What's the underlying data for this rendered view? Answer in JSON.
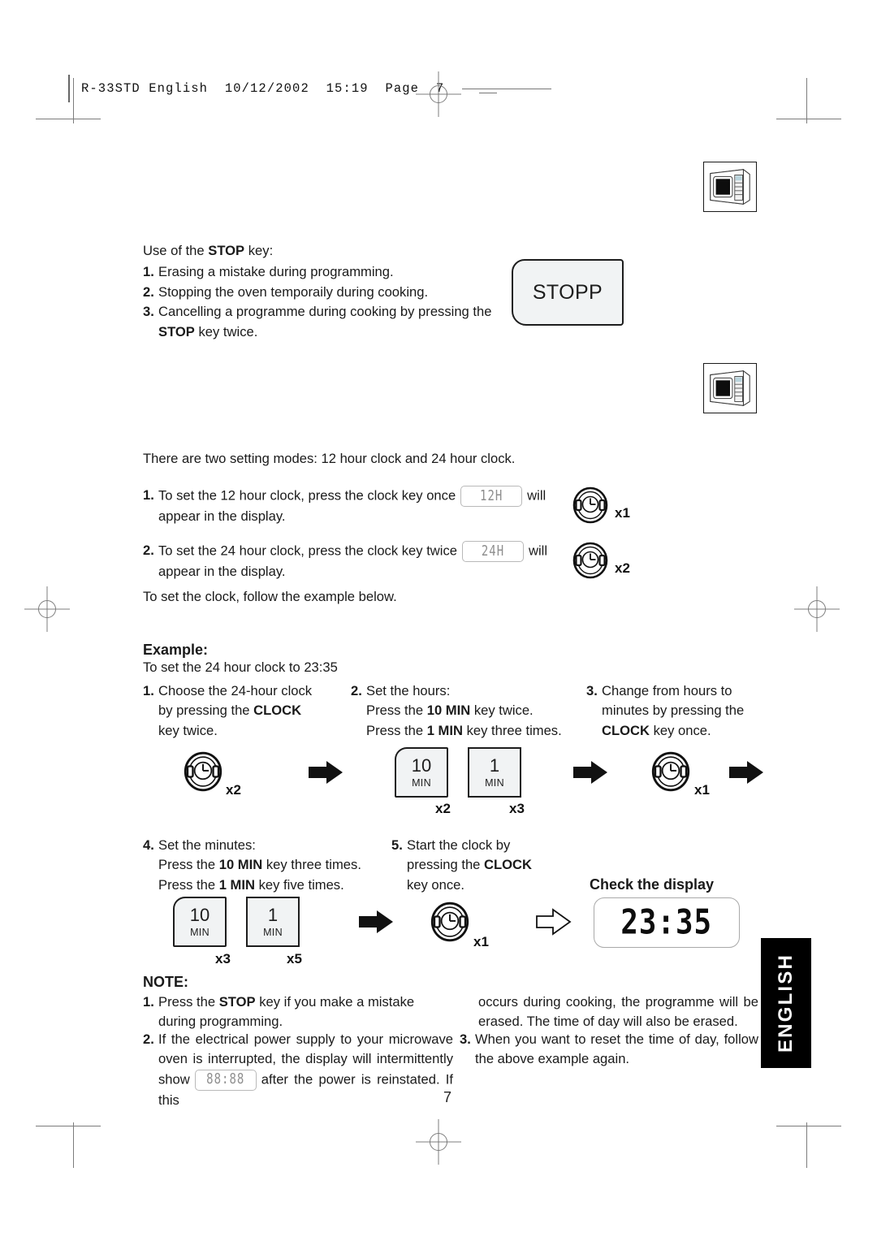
{
  "print_header": {
    "text": "R-33STD English  10/12/2002  15:19  Page  7"
  },
  "stop_section": {
    "intro_pre": "Use of the ",
    "intro_bold": "STOP",
    "intro_post": " key:",
    "items": [
      {
        "marker": "1.",
        "text": "Erasing a mistake during programming."
      },
      {
        "marker": "2.",
        "text": "Stopping the oven temporaily during cooking."
      },
      {
        "marker": "3.",
        "text_pre": "Cancelling a programme during cooking by pressing the ",
        "bold": "STOP",
        "text_post": " key twice."
      }
    ],
    "key_label": "STOPP"
  },
  "clock_section": {
    "intro": "There are two setting modes: 12 hour clock and 24 hour clock.",
    "items": [
      {
        "marker": "1.",
        "pre": "To set the 12 hour clock, press the clock key once",
        "display": "12H",
        "post": "will",
        "line2": "appear in the display.",
        "count": "x1"
      },
      {
        "marker": "2.",
        "pre": "To set the 24 hour clock, press the clock key twice",
        "display": "24H",
        "post": "will",
        "line2": "appear in the display.",
        "count": "x2"
      }
    ],
    "follow": "To set the clock, follow the example below."
  },
  "example": {
    "title": "Example:",
    "subtitle": "To set the 24 hour clock to 23:35",
    "steps_row1": [
      {
        "marker": "1.",
        "line1": "Choose the 24-hour clock",
        "line2_pre": "by pressing the ",
        "line2_bold": "CLOCK",
        "line3": "key twice."
      },
      {
        "marker": "2.",
        "line1": "Set the hours:",
        "line2_pre": "Press the ",
        "line2_bold": "10 MIN",
        "line2_post": " key twice.",
        "line3_pre": "Press the ",
        "line3_bold": "1 MIN",
        "line3_post": " key three times."
      },
      {
        "marker": "3.",
        "line1": "Change from hours to",
        "line2": "minutes by pressing the",
        "line3_bold": "CLOCK",
        "line3_post": " key once."
      }
    ],
    "icons_row1": {
      "clock1_count": "x2",
      "key_10min_label": "10",
      "key_10min_unit": "MIN",
      "key_10min_count": "x2",
      "key_1min_label": "1",
      "key_1min_unit": "MIN",
      "key_1min_count": "x3",
      "clock2_count": "x1"
    },
    "steps_row2": [
      {
        "marker": "4.",
        "line1": "Set the minutes:",
        "line2_pre": "Press the ",
        "line2_bold": "10 MIN",
        "line2_post": " key three times.",
        "line3_pre": "Press the ",
        "line3_bold": "1 MIN",
        "line3_post": " key five times."
      },
      {
        "marker": "5.",
        "line1": "Start the clock by",
        "line2_pre": "pressing the ",
        "line2_bold": "CLOCK",
        "line3": "key once."
      }
    ],
    "check_display_title": "Check the display",
    "icons_row2": {
      "key_10min_label": "10",
      "key_10min_unit": "MIN",
      "key_10min_count": "x3",
      "key_1min_label": "1",
      "key_1min_unit": "MIN",
      "key_1min_count": "x5",
      "clock_count": "x1",
      "display_value": "23:35"
    }
  },
  "note": {
    "title": "NOTE:",
    "item1": {
      "marker": "1.",
      "pre": "Press the ",
      "bold": "STOP",
      "post": " key if you make a mistake during programming."
    },
    "item2": {
      "marker": "2.",
      "pre": "If the electrical power supply to your microwave oven is interrupted, the display will intermittently show",
      "display": "88:88",
      "post": "after the power is reinstated. If this"
    },
    "item2_cont": "occurs during cooking, the programme will be erased. The time of day will also be erased.",
    "item3": {
      "marker": "3.",
      "text": "When you want to reset the time of day, follow the above example again."
    }
  },
  "language_tab": "ENGLISH",
  "page_number": "7"
}
